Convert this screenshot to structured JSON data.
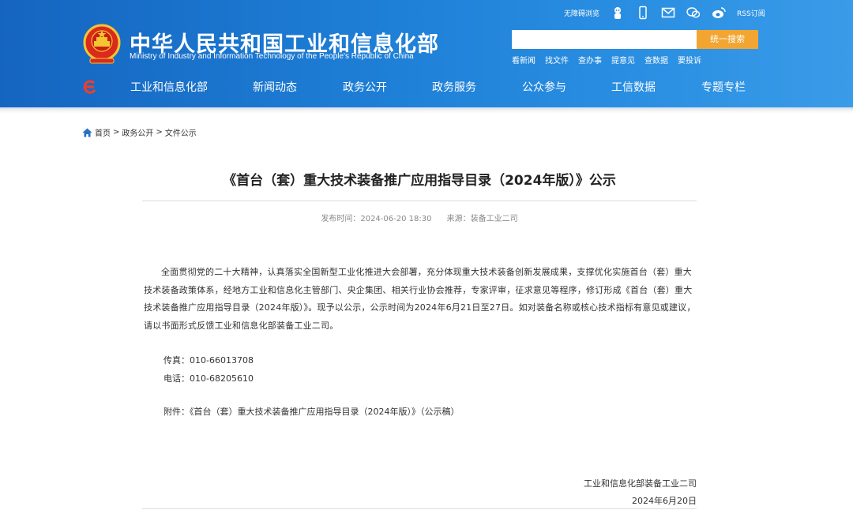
{
  "header": {
    "title_cn": "中华人民共和国工业和信息化部",
    "title_en": "Ministry of Industry and Information Technology of the People's Republic of China",
    "top_links": {
      "accessibility": "无障碍浏览",
      "rss": "RSS订阅",
      "icons": [
        "mascot-icon",
        "mobile-icon",
        "mail-icon",
        "wechat-icon",
        "weibo-icon"
      ]
    },
    "search": {
      "placeholder": "",
      "button": "统一搜索"
    },
    "quick_links": [
      "看新闻",
      "找文件",
      "查办事",
      "提意见",
      "查数据",
      "要投诉"
    ],
    "nav": [
      "工业和信息化部",
      "新闻动态",
      "政务公开",
      "政务服务",
      "公众参与",
      "工信数据",
      "专题专栏"
    ]
  },
  "breadcrumb": {
    "items": [
      "首页",
      "政务公开",
      "文件公示"
    ],
    "separator": ">"
  },
  "article": {
    "title": "《首台（套）重大技术装备推广应用指导目录（2024年版）》公示",
    "publish_time_label": "发布时间：2024-06-20 18:30",
    "source_label": "来源：装备工业二司",
    "body": "全面贯彻党的二十大精神，认真落实全国新型工业化推进大会部署，充分体现重大技术装备创新发展成果，支撑优化实施首台（套）重大技术装备政策体系，经地方工业和信息化主管部门、央企集团、相关行业协会推荐，专家评审，征求意见等程序，修订形成《首台（套）重大技术装备推广应用指导目录（2024年版）》。现予以公示，公示时间为2024年6月21日至27日。如对装备名称或核心技术指标有意见或建议，请以书面形式反馈工业和信息化部装备工业二司。",
    "fax": "传真：010-66013708",
    "phone": "电话：010-68205610",
    "attachment": "附件：《首台（套）重大技术装备推广应用指导目录（2024年版）》（公示稿）",
    "signature_org": "工业和信息化部装备工业二司",
    "signature_date": "2024年6月20日"
  },
  "colors": {
    "header_blue": "#1e7fd6",
    "search_orange": "#f2a531",
    "text": "#333333"
  }
}
